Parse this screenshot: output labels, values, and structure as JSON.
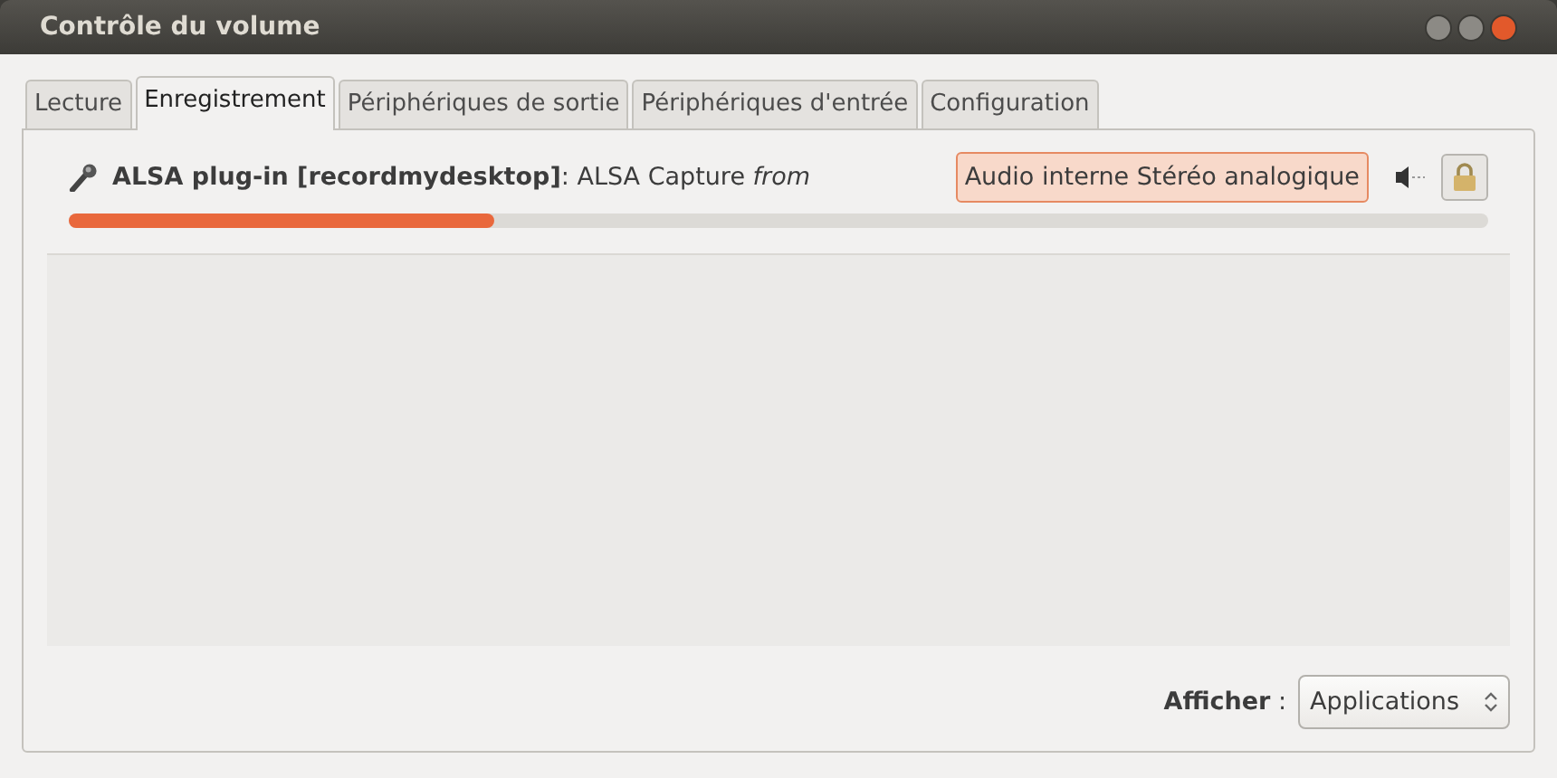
{
  "window": {
    "title": "Contrôle du volume"
  },
  "tabs": [
    {
      "label": "Lecture",
      "selected": false
    },
    {
      "label": "Enregistrement",
      "selected": true
    },
    {
      "label": "Périphériques de sortie",
      "selected": false
    },
    {
      "label": "Périphériques d'entrée",
      "selected": false
    },
    {
      "label": "Configuration",
      "selected": false
    }
  ],
  "streams": [
    {
      "title": "**ALSA plug-in [recordmydesktop]**: ALSA Capture  *from*",
      "device": "Audio interne Stéréo analogique",
      "level": 0.3
    }
  ],
  "footer": {
    "label": "**Afficher** :",
    "value": "Applications"
  }
}
